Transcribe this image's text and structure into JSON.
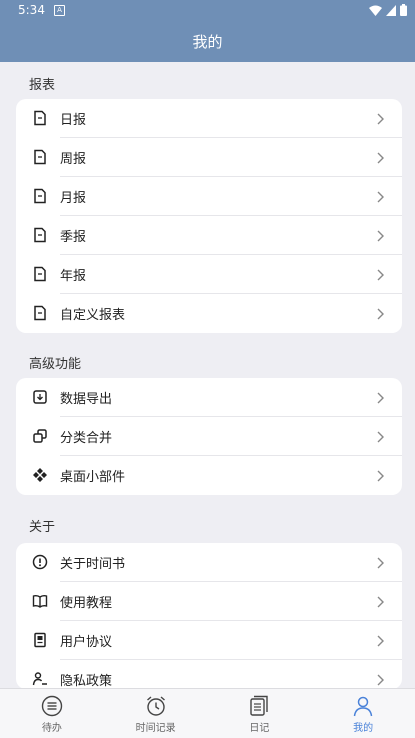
{
  "status_bar": {
    "time": "5:34",
    "notification_icon": "A"
  },
  "header": {
    "title": "我的"
  },
  "reports": {
    "title": "报表",
    "items": [
      {
        "label": "日报",
        "icon": "report-icon"
      },
      {
        "label": "周报",
        "icon": "report-icon"
      },
      {
        "label": "月报",
        "icon": "report-icon"
      },
      {
        "label": "季报",
        "icon": "report-icon"
      },
      {
        "label": "年报",
        "icon": "report-icon"
      },
      {
        "label": "自定义报表",
        "icon": "report-icon"
      }
    ]
  },
  "advanced": {
    "title": "高级功能",
    "items": [
      {
        "label": "数据导出",
        "icon": "export-icon"
      },
      {
        "label": "分类合并",
        "icon": "merge-icon"
      },
      {
        "label": "桌面小部件",
        "icon": "widget-icon"
      }
    ]
  },
  "about": {
    "title": "关于",
    "items": [
      {
        "label": "关于时间书",
        "icon": "info-icon"
      },
      {
        "label": "使用教程",
        "icon": "book-icon"
      },
      {
        "label": "用户协议",
        "icon": "agreement-icon"
      },
      {
        "label": "隐私政策",
        "icon": "privacy-icon"
      }
    ]
  },
  "tabbar": {
    "tabs": [
      {
        "label": "待办",
        "icon": "todo-icon",
        "active": false
      },
      {
        "label": "时间记录",
        "icon": "alarm-clock-icon",
        "active": false
      },
      {
        "label": "日记",
        "icon": "diary-icon",
        "active": false
      },
      {
        "label": "我的",
        "icon": "person-icon",
        "active": true
      }
    ]
  },
  "colors": {
    "header": "#6f8fb6",
    "accent": "#4a82d9",
    "background": "#eeeef3"
  }
}
